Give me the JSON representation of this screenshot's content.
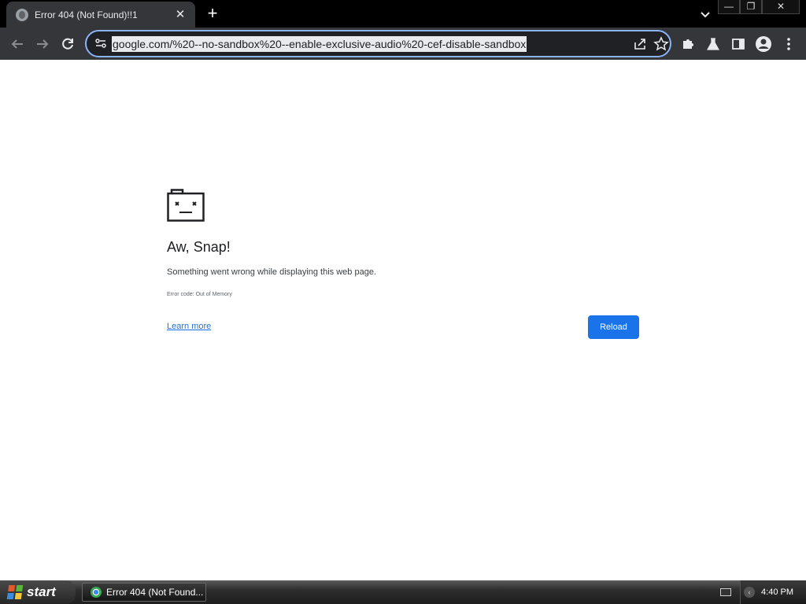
{
  "browser": {
    "tab": {
      "title": "Error 404 (Not Found)!!1",
      "close_glyph": "✕"
    },
    "new_tab_glyph": "+",
    "window_buttons": {
      "minimize": "—",
      "restore": "❐",
      "close": "✕"
    },
    "address_bar": {
      "url": "google.com/%20--no-sandbox%20--enable-exclusive-audio%20-cef-disable-sandbox"
    },
    "colors": {
      "tabstrip": "#000000",
      "toolbar": "#35363a",
      "focus_ring": "#8ab4f8"
    }
  },
  "error_page": {
    "title": "Aw, Snap!",
    "message": "Something went wrong while displaying this web page.",
    "error_code": "Error code: Out of Memory",
    "learn_more": "Learn more",
    "reload": "Reload",
    "colors": {
      "accent": "#1a73e8"
    }
  },
  "taskbar": {
    "start_label": "start",
    "task_item_label": "Error 404 (Not Found...",
    "clock": "4:40 PM"
  }
}
